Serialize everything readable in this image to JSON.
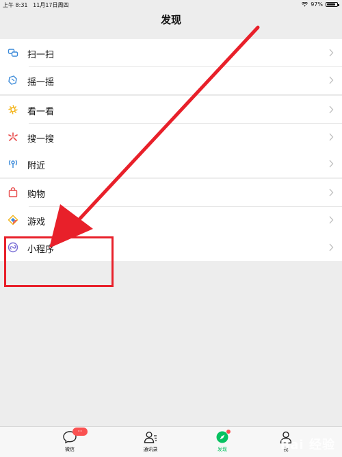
{
  "status_bar": {
    "time": "上午 8:31",
    "date": "11月17日周四",
    "battery": "97%"
  },
  "nav": {
    "title": "发现"
  },
  "groups": [
    {
      "items": [
        {
          "label": "扫一扫",
          "icon": "scan-icon"
        },
        {
          "label": "摇一摇",
          "icon": "shake-icon"
        }
      ]
    },
    {
      "items": [
        {
          "label": "看一看",
          "icon": "look-icon"
        },
        {
          "label": "搜一搜",
          "icon": "search-icon"
        }
      ]
    },
    {
      "items": [
        {
          "label": "附近",
          "icon": "nearby-icon"
        }
      ]
    },
    {
      "items": [
        {
          "label": "购物",
          "icon": "shopping-bag-icon"
        },
        {
          "label": "游戏",
          "icon": "game-icon"
        }
      ]
    },
    {
      "items": [
        {
          "label": "小程序",
          "icon": "mini-program-icon"
        }
      ]
    }
  ],
  "tabbar": {
    "tabs": [
      {
        "label": "微信",
        "badge": "···"
      },
      {
        "label": "通讯录"
      },
      {
        "label": "发现"
      },
      {
        "label": "我"
      }
    ]
  },
  "watermark": "Bai 经验",
  "colors": {
    "accent": "#07c160",
    "annotation": "#e8202a",
    "badge": "#fa5151"
  }
}
